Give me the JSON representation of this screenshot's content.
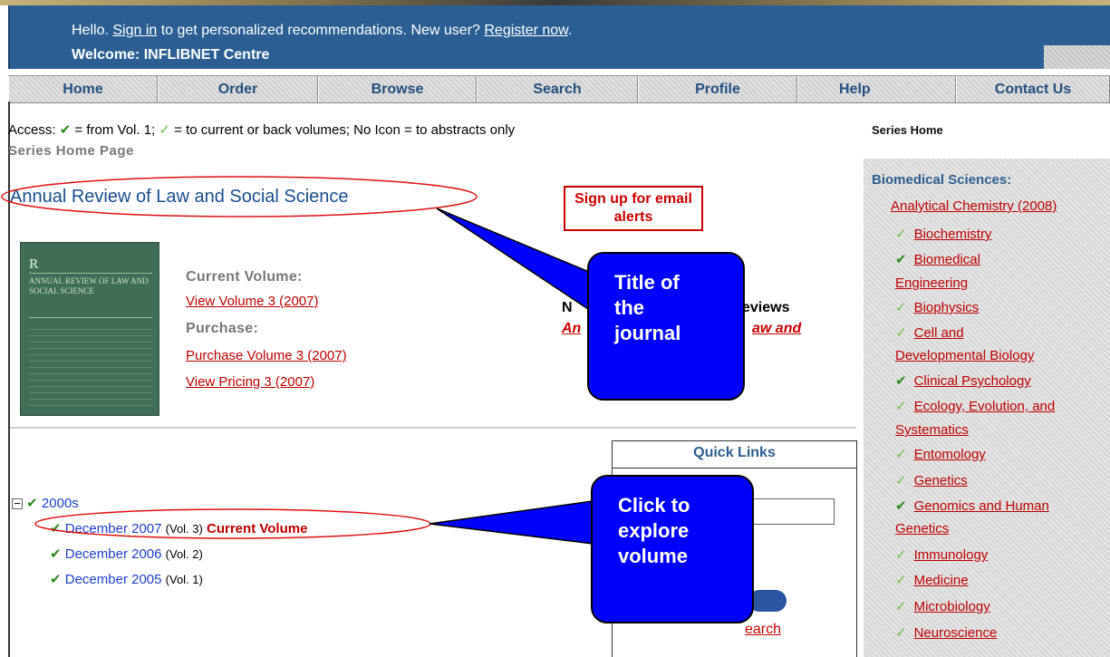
{
  "header": {
    "hello_prefix": "Hello. ",
    "sign_in": "Sign in",
    "hello_mid": " to get personalized recommendations. New user? ",
    "register": "Register now",
    "hello_end": ".",
    "welcome": "Welcome: INFLIBNET Centre"
  },
  "nav": [
    "Home",
    "Order",
    "Browse",
    "Search",
    "Profile",
    "Help",
    "Contact Us"
  ],
  "access": {
    "prefix": "Access: ",
    "full": " = from Vol. 1; ",
    "partial": " = to current or back volumes; No Icon = to abstracts only"
  },
  "series_home_page": "Series Home Page",
  "journal_title": "Annual Review of Law and Social Science",
  "signup_alerts": "Sign up for email alerts",
  "cover": {
    "title": "ANNUAL REVIEW OF LAW AND SOCIAL SCIENCE"
  },
  "volume": {
    "current_label": "Current Volume:",
    "view_link": "View Volume 3 (2007)",
    "purchase_label": "Purchase:",
    "purchase_link": "Purchase Volume 3 (2007)",
    "pricing_link": "View Pricing 3 (2007)"
  },
  "partial_visible": {
    "n": "N",
    "eviews": "eviews",
    "an": "An",
    "aw_and": "aw and"
  },
  "tree": {
    "decade": "2000s",
    "items": [
      {
        "date": "December 2007",
        "vol": "(Vol. 3)",
        "tag": "Current Volume"
      },
      {
        "date": "December 2006",
        "vol": "(Vol. 2)",
        "tag": ""
      },
      {
        "date": "December 2005",
        "vol": "(Vol. 1)",
        "tag": ""
      }
    ]
  },
  "quick_links": {
    "title": "Quick Links",
    "search_fragment": "earch"
  },
  "series_home": "Series Home",
  "sidebar": {
    "heading": "Biomedical Sciences:",
    "first": "Analytical Chemistry (2008)",
    "items": [
      {
        "label": "Biochemistry",
        "access": "partial"
      },
      {
        "label": "Biomedical",
        "cont": "Engineering",
        "access": "full"
      },
      {
        "label": "Biophysics",
        "access": "partial"
      },
      {
        "label": "Cell and",
        "cont": "Developmental Biology",
        "access": "partial"
      },
      {
        "label": "Clinical Psychology",
        "access": "full"
      },
      {
        "label": "Ecology, Evolution, and",
        "cont": "Systematics",
        "access": "partial"
      },
      {
        "label": "Entomology",
        "access": "partial"
      },
      {
        "label": "Genetics",
        "access": "partial"
      },
      {
        "label": "Genomics and Human",
        "cont": "Genetics",
        "access": "full"
      },
      {
        "label": "Immunology",
        "access": "partial"
      },
      {
        "label": "Medicine",
        "access": "partial"
      },
      {
        "label": "Microbiology",
        "access": "partial"
      },
      {
        "label": "Neuroscience",
        "access": "partial"
      }
    ]
  },
  "callouts": {
    "title": "Title of the journal",
    "explore": "Click to explore volume"
  },
  "colors": {
    "header_bg": "#2b5f93",
    "link_red": "#c00000",
    "callout_blue": "#0000ff",
    "annotation_red": "#e01010"
  }
}
